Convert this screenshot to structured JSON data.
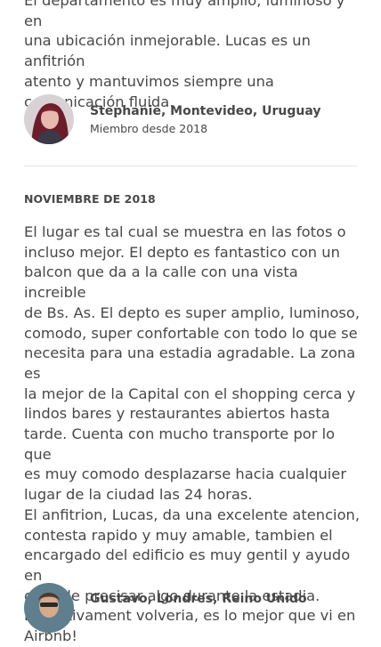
{
  "review1": {
    "text": "El departamento es muy amplio, luminoso y en\nuna ubicación inmejorable. Lucas es un anfitrión\natento y mantuvimos siempre una\ncomunicación fluida.",
    "reviewer_name": "Stephanie, Montevideo, Uruguay",
    "member_since": "Miembro desde 2018"
  },
  "review2": {
    "date": "NOVIEMBRE DE 2018",
    "text": "El lugar es tal cual se muestra en las fotos o\nincluso mejor. El depto es fantastico con un\nbalcon que da a la calle con una vista increible\nde Bs. As. El depto es super amplio, luminoso,\ncomodo, super confortable con todo lo que se\nnecesita para una estadia agradable. La zona es\nla mejor de la Capital con el shopping cerca y\nlindos bares y restaurantes abiertos hasta\ntarde. Cuenta con mucho transporte por lo que\nes muy comodo desplazarse hacia cualquier\nlugar de la ciudad las 24 horas.\nEl anfitrion, Lucas, da una excelente atencion,\ncontesta rapido y muy amable, tambien el\nencargado del edificio es muy gentil y ayudo en\ncaso de precisar algo durante la estadia.\nDefinitivament volveria,  es lo mejor que vi en\nAirbnb!"
  },
  "review3": {
    "reviewer_name": "Gustavo, Londres, Reino Unido"
  },
  "colors": {
    "text": "#484848",
    "divider": "#e4e4e4"
  }
}
